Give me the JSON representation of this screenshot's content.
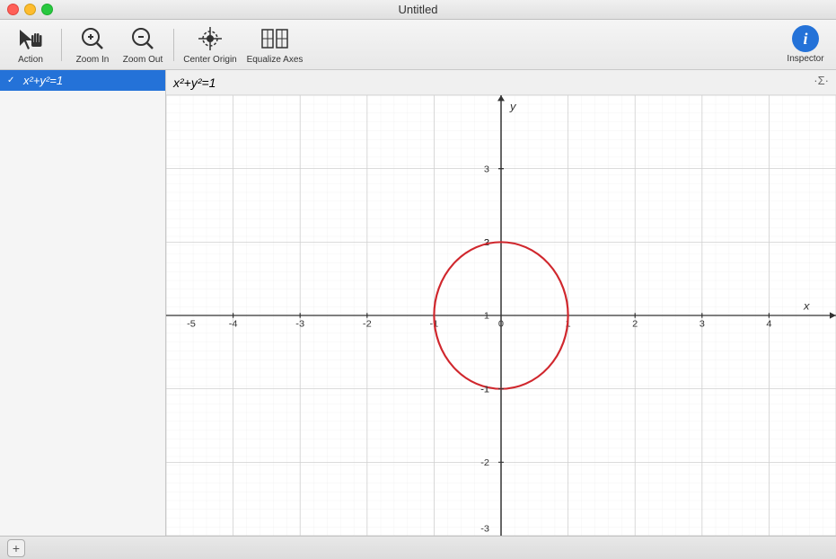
{
  "window": {
    "title": "Untitled"
  },
  "toolbar": {
    "action_label": "Action",
    "zoom_in_label": "Zoom In",
    "zoom_out_label": "Zoom Out",
    "center_origin_label": "Center Origin",
    "equalize_axes_label": "Equalize Axes",
    "inspector_label": "Inspector"
  },
  "sidebar": {
    "items": [
      {
        "id": "eq1",
        "label": "x²+y²=1",
        "selected": true,
        "has_check": true
      }
    ]
  },
  "graph": {
    "header_equation": "x²+y²=1",
    "sigma_symbol": "·Σ·",
    "x_label": "x",
    "y_label": "y",
    "x_min": -5,
    "x_max": 5,
    "y_min": -3,
    "y_max": 3,
    "x_ticks": [
      -4,
      -3,
      -2,
      -1,
      0,
      1,
      2,
      3,
      4
    ],
    "y_ticks": [
      -3,
      -2,
      -1,
      1,
      2,
      3
    ],
    "circle": {
      "cx_data": 0,
      "cy_data": 0,
      "r_data": 1,
      "color": "#d0272d"
    }
  },
  "bottom": {
    "add_label": "+"
  }
}
